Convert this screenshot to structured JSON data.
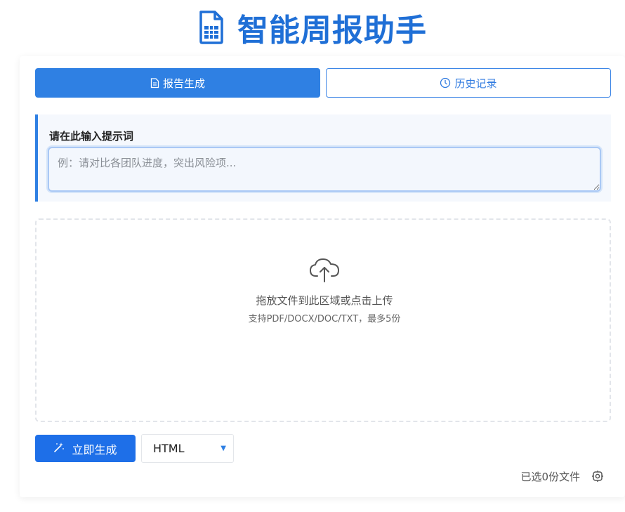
{
  "app": {
    "title": "智能周报助手",
    "logo_icon": "document-icon",
    "accent_color": "#1f6fd6"
  },
  "tabs": [
    {
      "label": "报告生成",
      "icon": "document-icon",
      "active": true
    },
    {
      "label": "历史记录",
      "icon": "clock-icon",
      "active": false
    }
  ],
  "prompt": {
    "label": "请在此输入提示词",
    "placeholder": "例：请对比各团队进度，突出风险项...",
    "value": ""
  },
  "upload": {
    "icon": "cloud-upload-icon",
    "main_text": "拖放文件到此区域或点击上传",
    "sub_text": "支持PDF/DOCX/DOC/TXT，最多5份"
  },
  "actions": {
    "generate_label": "立即生成",
    "generate_icon": "magic-wand-icon",
    "format_value": "HTML",
    "format_arrow": "▼"
  },
  "status": {
    "selected_text": "已选0份文件",
    "settings_icon": "settings-icon"
  }
}
